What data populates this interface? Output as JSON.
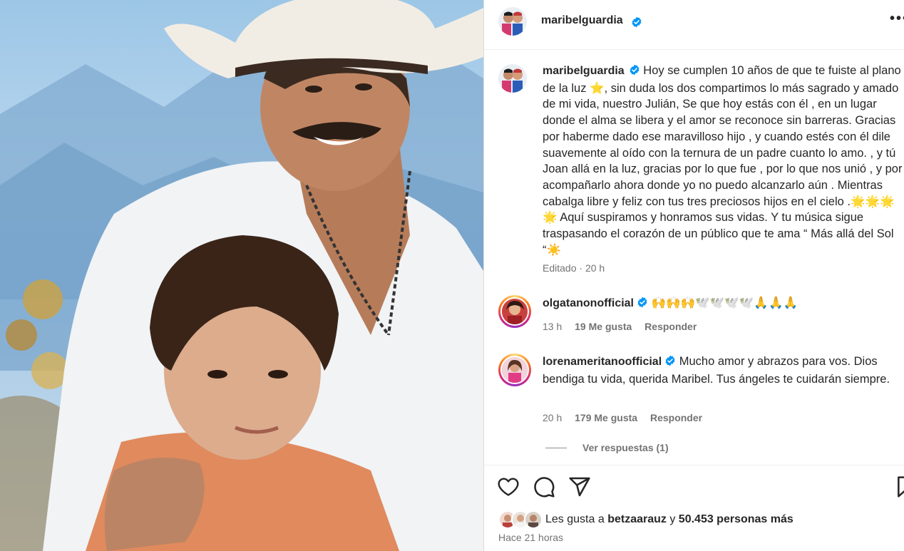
{
  "post": {
    "author": "maribelguardia",
    "author_verified": true,
    "more_icon": "more-options-icon"
  },
  "caption": {
    "username": "maribelguardia",
    "text": "Hoy se cumplen 10 años de que te fuiste al plano de la luz ⭐️, sin duda los dos compartimos lo más sagrado y amado de mi vida, nuestro Julián, Se que hoy estás con él , en un lugar donde el alma se libera y el amor se reconoce sin barreras. Gracias por haberme dado ese maravilloso hijo , y cuando estés con él dile suavemente al oído con la ternura de un padre cuanto lo amo. , y tú Joan allá en la luz, gracias por lo que fue , por lo que nos unió , y por acompañarlo ahora donde yo no puedo alcanzarlo aún . Mientras cabalga libre y feliz con tus tres preciosos hijos en el cielo .🌟🌟🌟🌟 Aquí suspiramos y honramos sus vidas. Y tu música sigue traspasando el corazón de un público que te ama “ Más allá del Sol “☀️",
    "edited": "Editado",
    "separator": "·",
    "time": "20 h"
  },
  "comments": [
    {
      "username": "olgatanonofficial",
      "verified": true,
      "text": "🙌🙌🙌🕊️🕊️🕊️🕊️🙏🙏🙏",
      "time": "13 h",
      "likes": "19 Me gusta",
      "reply": "Responder"
    },
    {
      "username": "lorenameritanoofficial",
      "verified": true,
      "text": "Mucho amor y abrazos para vos. Dios bendiga tu vida, querida Maribel. Tus ángeles te cuidarán siempre.",
      "time": "20 h",
      "likes": "179 Me gusta",
      "reply": "Responder",
      "view_replies": "Ver respuestas (1)"
    }
  ],
  "actions": {
    "like_icon": "heart-icon",
    "comment_icon": "comment-icon",
    "share_icon": "share-icon",
    "save_icon": "bookmark-icon"
  },
  "likes": {
    "prefix": "Les gusta a",
    "user": "betzaarauz",
    "connector": "y",
    "others": "50.453 personas más"
  },
  "posted": "Hace 21 horas",
  "colors": {
    "verified_blue": "#0095f6",
    "text": "#262626",
    "muted": "#737373"
  }
}
